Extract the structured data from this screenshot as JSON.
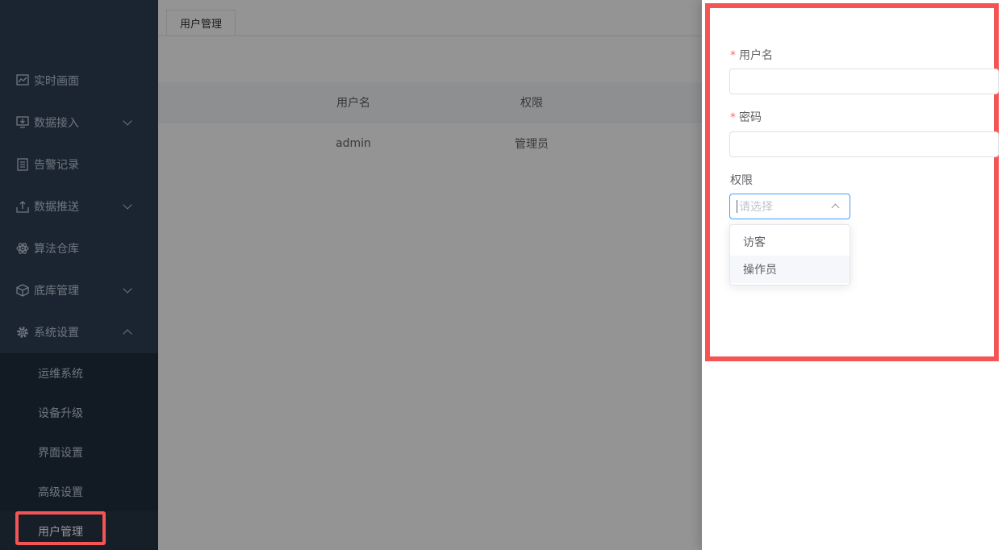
{
  "sidebar": {
    "items": [
      {
        "label": "实时画面",
        "icon": "line-chart-icon"
      },
      {
        "label": "数据接入",
        "icon": "monitor-download-icon"
      },
      {
        "label": "告警记录",
        "icon": "document-list-icon"
      },
      {
        "label": "数据推送",
        "icon": "upload-tray-icon"
      },
      {
        "label": "算法仓库",
        "icon": "atom-icon"
      },
      {
        "label": "底库管理",
        "icon": "cube-icon"
      },
      {
        "label": "系统设置",
        "icon": "gear-icon"
      }
    ],
    "sub_items": [
      {
        "label": "运维系统"
      },
      {
        "label": "设备升级"
      },
      {
        "label": "界面设置"
      },
      {
        "label": "高级设置"
      },
      {
        "label": "用户管理"
      }
    ]
  },
  "tabs": [
    {
      "label": "用户管理"
    }
  ],
  "table": {
    "columns": [
      "用户名",
      "权限"
    ],
    "rows": [
      [
        "admin",
        "管理员"
      ]
    ]
  },
  "drawer": {
    "username_label": "用户名",
    "password_label": "密码",
    "role_label": "权限",
    "role_placeholder": "请选择",
    "role_options": [
      "访客",
      "操作员"
    ]
  },
  "colors": {
    "sidebar_bg": "#304156",
    "highlight": "#f55454",
    "required": "#f56c6c",
    "focus": "#409eff"
  }
}
